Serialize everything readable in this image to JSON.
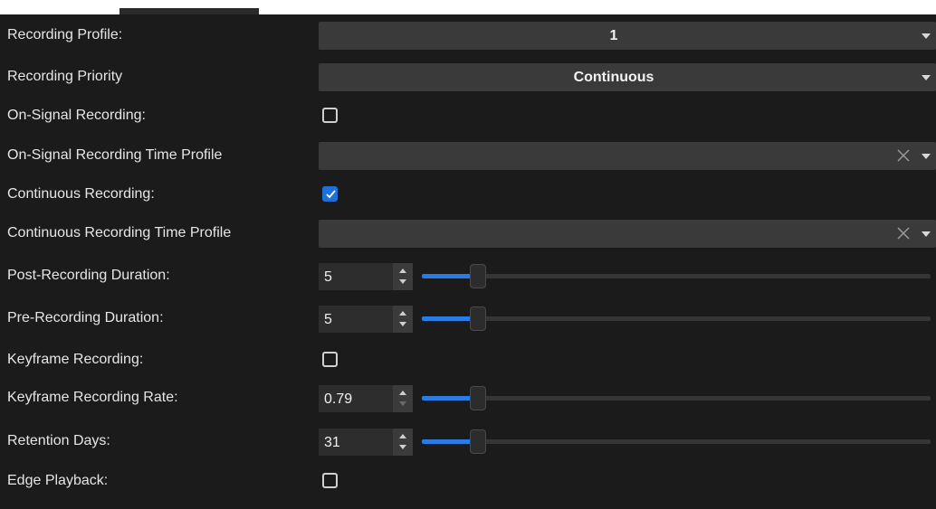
{
  "settings": {
    "recording_profile": {
      "label": "Recording Profile:",
      "value": "1"
    },
    "recording_priority": {
      "label": "Recording Priority",
      "value": "Continuous"
    },
    "on_signal_recording": {
      "label": "On-Signal Recording:",
      "checked": false
    },
    "on_signal_time_profile": {
      "label": "On-Signal Recording Time Profile",
      "value": ""
    },
    "continuous_recording": {
      "label": "Continuous Recording:",
      "checked": true
    },
    "continuous_time_profile": {
      "label": "Continuous Recording Time Profile",
      "value": ""
    },
    "post_recording_duration": {
      "label": "Post-Recording Duration:",
      "value": "5",
      "slider_fraction": 0.09
    },
    "pre_recording_duration": {
      "label": "Pre-Recording Duration:",
      "value": "5",
      "slider_fraction": 0.09
    },
    "keyframe_recording": {
      "label": "Keyframe Recording:",
      "checked": false
    },
    "keyframe_recording_rate": {
      "label": "Keyframe Recording Rate:",
      "value": "0.79",
      "slider_fraction": 0.09
    },
    "retention_days": {
      "label": "Retention Days:",
      "value": "31",
      "slider_fraction": 0.09
    },
    "edge_playback": {
      "label": "Edge Playback:",
      "checked": false
    }
  },
  "colors": {
    "background": "#1b1b1b",
    "accent": "#2a7be4",
    "checkbox_checked": "#1f6fd6",
    "field": "#3a3a3a"
  },
  "icons": {
    "dropdown": "chevron-down-icon",
    "clear": "close-icon",
    "check": "checkmark-icon",
    "spin_up": "arrow-up-icon",
    "spin_down": "arrow-down-icon"
  }
}
